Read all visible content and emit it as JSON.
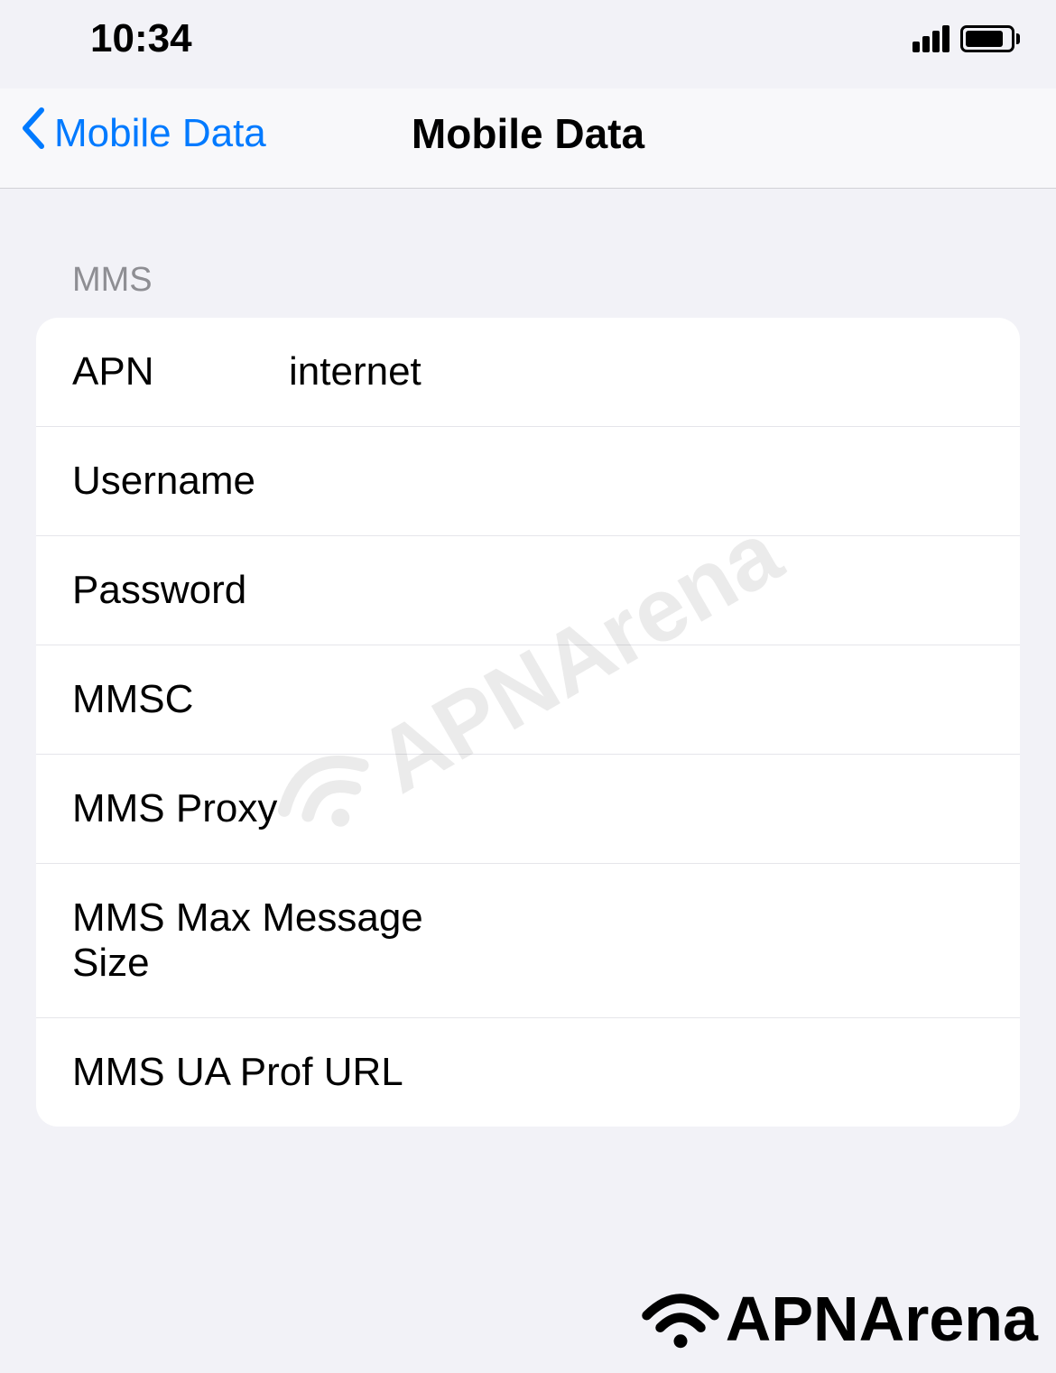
{
  "statusBar": {
    "time": "10:34"
  },
  "nav": {
    "back_label": "Mobile Data",
    "title": "Mobile Data"
  },
  "section": {
    "header": "MMS"
  },
  "fields": {
    "apn": {
      "label": "APN",
      "value": "internet"
    },
    "username": {
      "label": "Username",
      "value": ""
    },
    "password": {
      "label": "Password",
      "value": ""
    },
    "mmsc": {
      "label": "MMSC",
      "value": ""
    },
    "mmsProxy": {
      "label": "MMS Proxy",
      "value": ""
    },
    "mmsMaxSize": {
      "label": "MMS Max Message Size",
      "value": ""
    },
    "mmsUaProf": {
      "label": "MMS UA Prof URL",
      "value": ""
    }
  },
  "watermark": {
    "text": "APNArena"
  },
  "footer": {
    "logo_text": "APNArena"
  }
}
